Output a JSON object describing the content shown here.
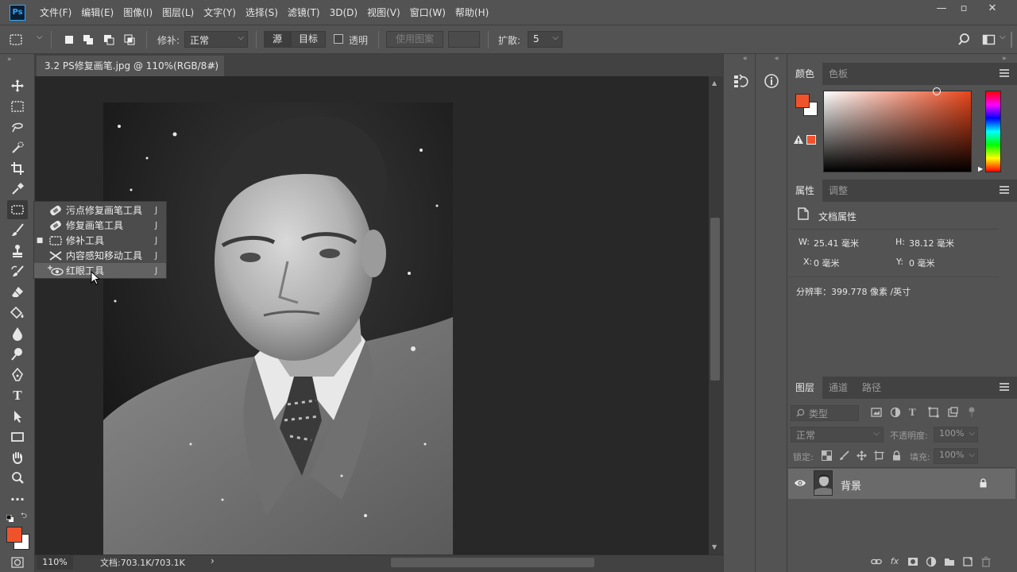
{
  "app": {
    "logo": "Ps"
  },
  "menu": [
    "文件(F)",
    "编辑(E)",
    "图像(I)",
    "图层(L)",
    "文字(Y)",
    "选择(S)",
    "滤镜(T)",
    "3D(D)",
    "视图(V)",
    "窗口(W)",
    "帮助(H)"
  ],
  "window_controls": {
    "minimize": "—",
    "restore": "▫",
    "close": "✕"
  },
  "options": {
    "patch_label": "修补:",
    "patch_mode": "正常",
    "source_label": "源",
    "target_label": "目标",
    "transparent_label": "透明",
    "use_pattern_label": "使用图案",
    "diffusion_label": "扩散:",
    "diffusion_value": "5"
  },
  "document": {
    "tab_title": "3.2 PS修复画笔.jpg @ 110%(RGB/8#)",
    "tab_close": "×",
    "zoom": "110%",
    "doc_size": "文档:703.1K/703.1K",
    "status_arrow": "›"
  },
  "flyout": {
    "items": [
      {
        "label": "污点修复画笔工具",
        "key": "J",
        "icon": "spot-healing-brush-icon",
        "selected": false,
        "hover": false
      },
      {
        "label": "修复画笔工具",
        "key": "J",
        "icon": "healing-brush-icon",
        "selected": false,
        "hover": false
      },
      {
        "label": "修补工具",
        "key": "J",
        "icon": "patch-icon",
        "selected": true,
        "hover": false
      },
      {
        "label": "内容感知移动工具",
        "key": "J",
        "icon": "content-aware-move-icon",
        "selected": false,
        "hover": false
      },
      {
        "label": "红眼工具",
        "key": "J",
        "icon": "red-eye-icon",
        "selected": false,
        "hover": true
      }
    ],
    "bullet": "■"
  },
  "colors": {
    "foreground": "#f0532b",
    "background": "#ffffff",
    "accent": "#31a8ff"
  },
  "panels": {
    "color_tab": "颜色",
    "swatches_tab": "色板",
    "properties_tab": "属性",
    "adjustments_tab": "调整",
    "doc_props_title": "文档属性",
    "width_label": "W:",
    "width_value": "25.41 毫米",
    "height_label": "H:",
    "height_value": "38.12 毫米",
    "x_label": "X:",
    "x_value": "0 毫米",
    "y_label": "Y:",
    "y_value": "0 毫米",
    "resolution": "分辨率：399.778 像素 /英寸",
    "layers_tab": "图层",
    "channels_tab": "通道",
    "paths_tab": "路径",
    "filter_type": "类型",
    "blend_mode": "正常",
    "opacity_label": "不透明度:",
    "opacity_value": "100%",
    "lock_label": "锁定:",
    "fill_label": "填充:",
    "fill_value": "100%",
    "layer_name": "背景"
  },
  "layers_footer": {
    "fx": "fx"
  }
}
